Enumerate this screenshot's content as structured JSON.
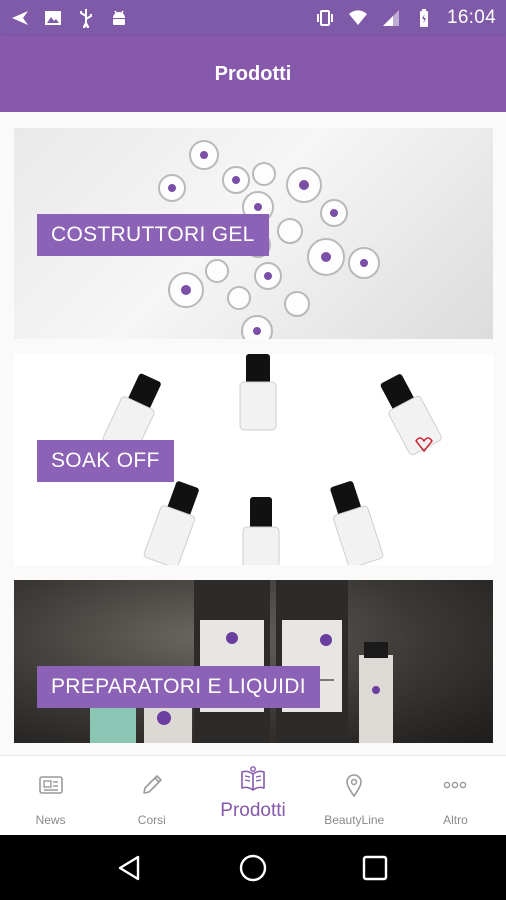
{
  "status_bar": {
    "time": "16:04",
    "left_icons": [
      "send-icon",
      "image-icon",
      "usb-icon",
      "android-icon"
    ],
    "right_icons": [
      "vibrate-icon",
      "wifi-icon",
      "signal-icon",
      "battery-icon"
    ]
  },
  "app_bar": {
    "title": "Prodotti"
  },
  "categories": [
    {
      "label": "COSTRUTTORI GEL"
    },
    {
      "label": "SOAK OFF"
    },
    {
      "label": "PREPARATORI E LIQUIDI"
    }
  ],
  "bottom_nav": {
    "items": [
      {
        "label": "News",
        "icon": "news-icon",
        "active": false
      },
      {
        "label": "Corsi",
        "icon": "pencil-icon",
        "active": false
      },
      {
        "label": "Prodotti",
        "icon": "book-icon",
        "active": true
      },
      {
        "label": "BeautyLine",
        "icon": "map-pin-icon",
        "active": false
      },
      {
        "label": "Altro",
        "icon": "more-dots-icon",
        "active": false
      }
    ]
  },
  "system_nav": [
    "back-icon",
    "home-icon",
    "recents-icon"
  ],
  "colors": {
    "primary": "#8659ad",
    "status_bar": "#7f5aa8",
    "label_bg": "#8b62b6",
    "nav_inactive": "#8a8a8a"
  }
}
